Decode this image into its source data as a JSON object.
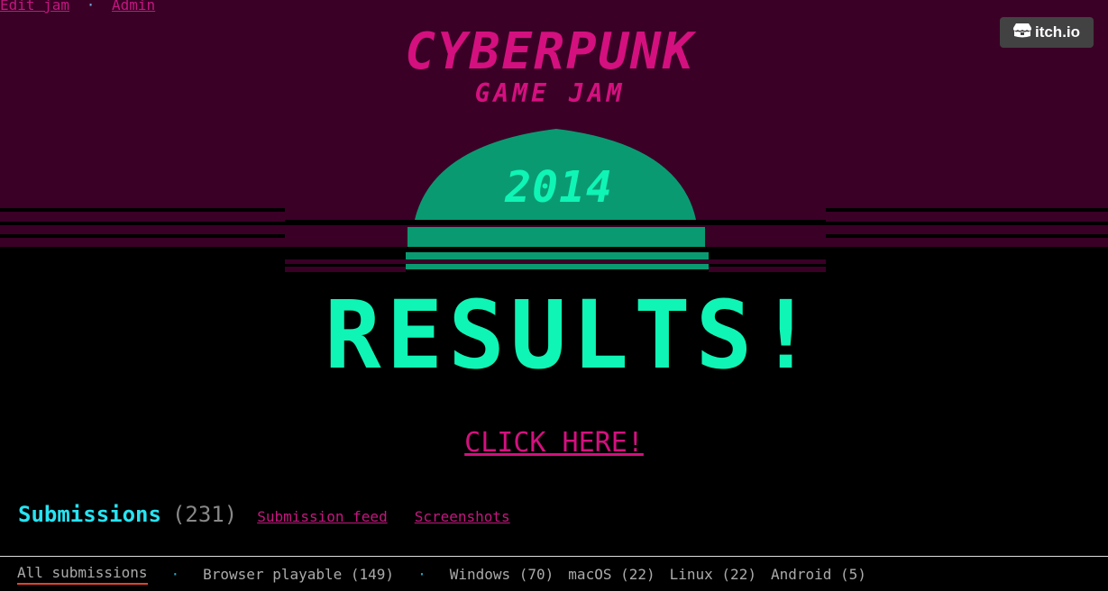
{
  "admin_links": {
    "edit_jam": "Edit jam",
    "separator": "·",
    "admin": "Admin"
  },
  "itch_button": {
    "label": "itch.io",
    "icon": "itchio-logo-icon"
  },
  "banner": {
    "title": "CYBERPUNK",
    "subtitle": "GAME JAM",
    "year": "2014",
    "results": "RESULTS!",
    "colors": {
      "background": "#3a0026",
      "accent_pink": "#d4107f",
      "sun": "#0a9a72",
      "cyan": "#0ff5b5"
    }
  },
  "cta": {
    "label": "CLICK HERE!"
  },
  "submissions": {
    "title": "Submissions",
    "count": "(231)",
    "links": [
      "Submission feed",
      "Screenshots"
    ]
  },
  "filters": [
    {
      "label": "All submissions",
      "active": true
    },
    {
      "label": "Browser playable (149)"
    },
    {
      "label": "Windows (70)"
    },
    {
      "label": "macOS (22)"
    },
    {
      "label": "Linux (22)"
    },
    {
      "label": "Android (5)"
    }
  ],
  "filter_separator": "·"
}
